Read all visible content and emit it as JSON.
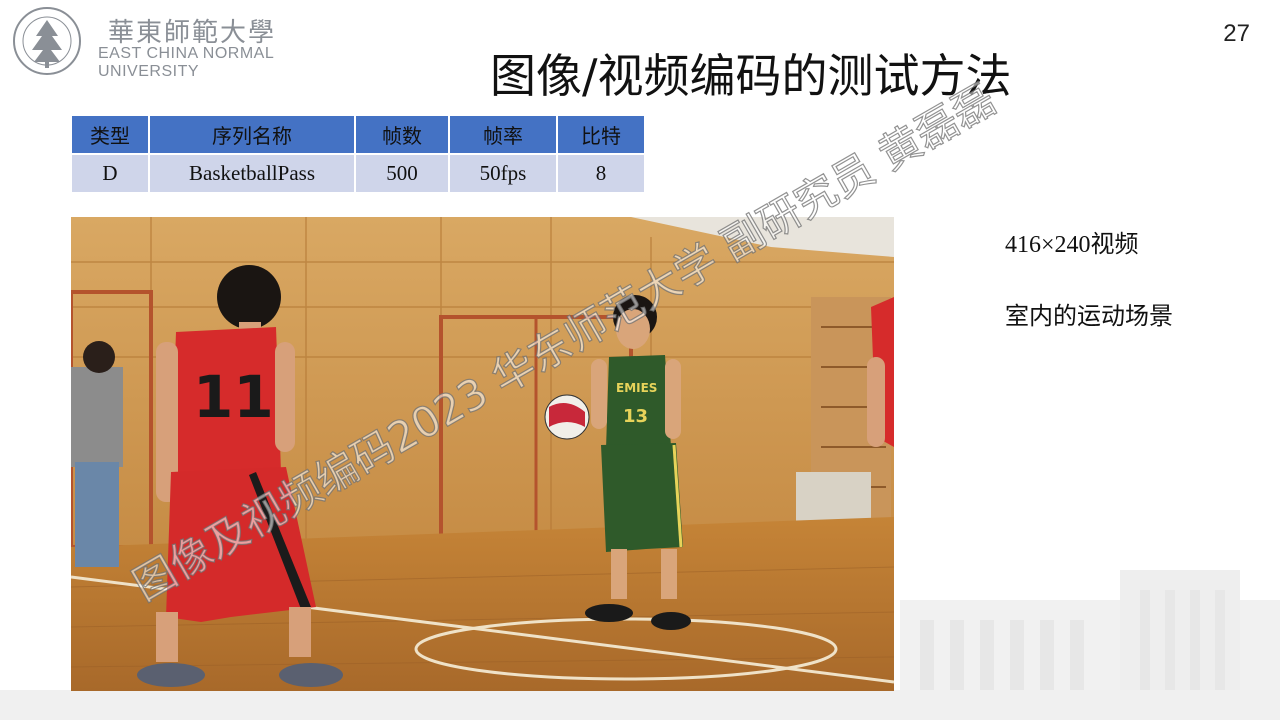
{
  "header": {
    "logo_cn": "華東師範大學",
    "logo_en_line1": "EAST CHINA NORMAL",
    "logo_en_line2": "UNIVERSITY",
    "page_number": "27",
    "title": "图像/视频编码的测试方法"
  },
  "table": {
    "headers": [
      "类型",
      "序列名称",
      "帧数",
      "帧率",
      "比特"
    ],
    "rows": [
      [
        "D",
        "BasketballPass",
        "500",
        "50fps",
        "8"
      ]
    ]
  },
  "side": {
    "resolution": "416×240视频",
    "description": "室内的运动场景"
  },
  "watermark": "图像及视频编码2023 华东师范大学 副研究员 黄磊磊",
  "colors": {
    "table_header": "#4472c4",
    "table_cell": "#cfd5ea",
    "jersey_red": "#d42b2b",
    "jersey_green": "#2f5a2a",
    "floor_wood": "#b9782f",
    "wall_wood": "#d7a35e"
  }
}
